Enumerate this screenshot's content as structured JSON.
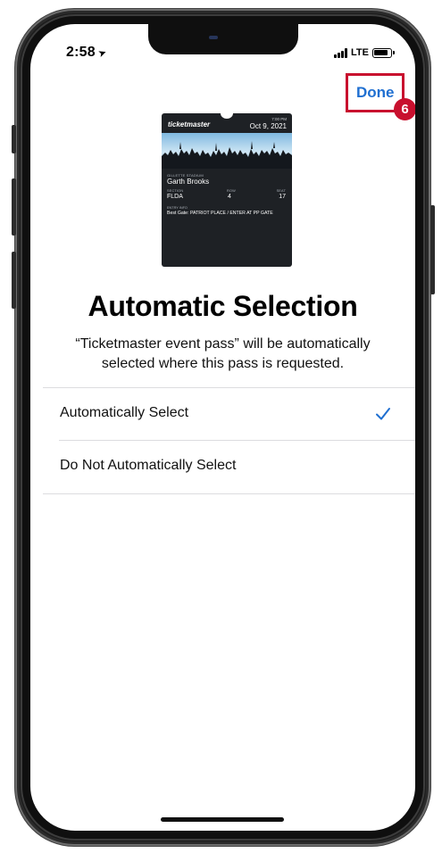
{
  "status_bar": {
    "time": "2:58",
    "location_icon": "location-arrow-icon",
    "network": "LTE",
    "signal_icon": "cellular-signal-icon",
    "battery_icon": "battery-icon"
  },
  "nav": {
    "done_label": "Done",
    "step_number": "6"
  },
  "pass": {
    "brand": "ticketmaster",
    "time": "7:00 PM",
    "date": "Oct 9, 2021",
    "venue": "GILLETTE STADIUM",
    "artist": "Garth Brooks",
    "section_label": "SECTION",
    "section_value": "FLDA",
    "row_label": "ROW",
    "row_value": "4",
    "seat_label": "SEAT",
    "seat_value": "17",
    "entry_label": "ENTRY INFO",
    "entry_value": "Best Gate: PATRIOT PLACE / ENTER AT PP GATE"
  },
  "main": {
    "title": "Automatic Selection",
    "description": "“Ticketmaster event pass” will be automatically selected where this pass is requested.",
    "options": [
      {
        "label": "Automatically Select",
        "selected": true
      },
      {
        "label": "Do Not Automatically Select",
        "selected": false
      }
    ]
  },
  "colors": {
    "accent": "#1f6fd1",
    "highlight": "#c8102e",
    "pass_background": "#1e2125"
  }
}
